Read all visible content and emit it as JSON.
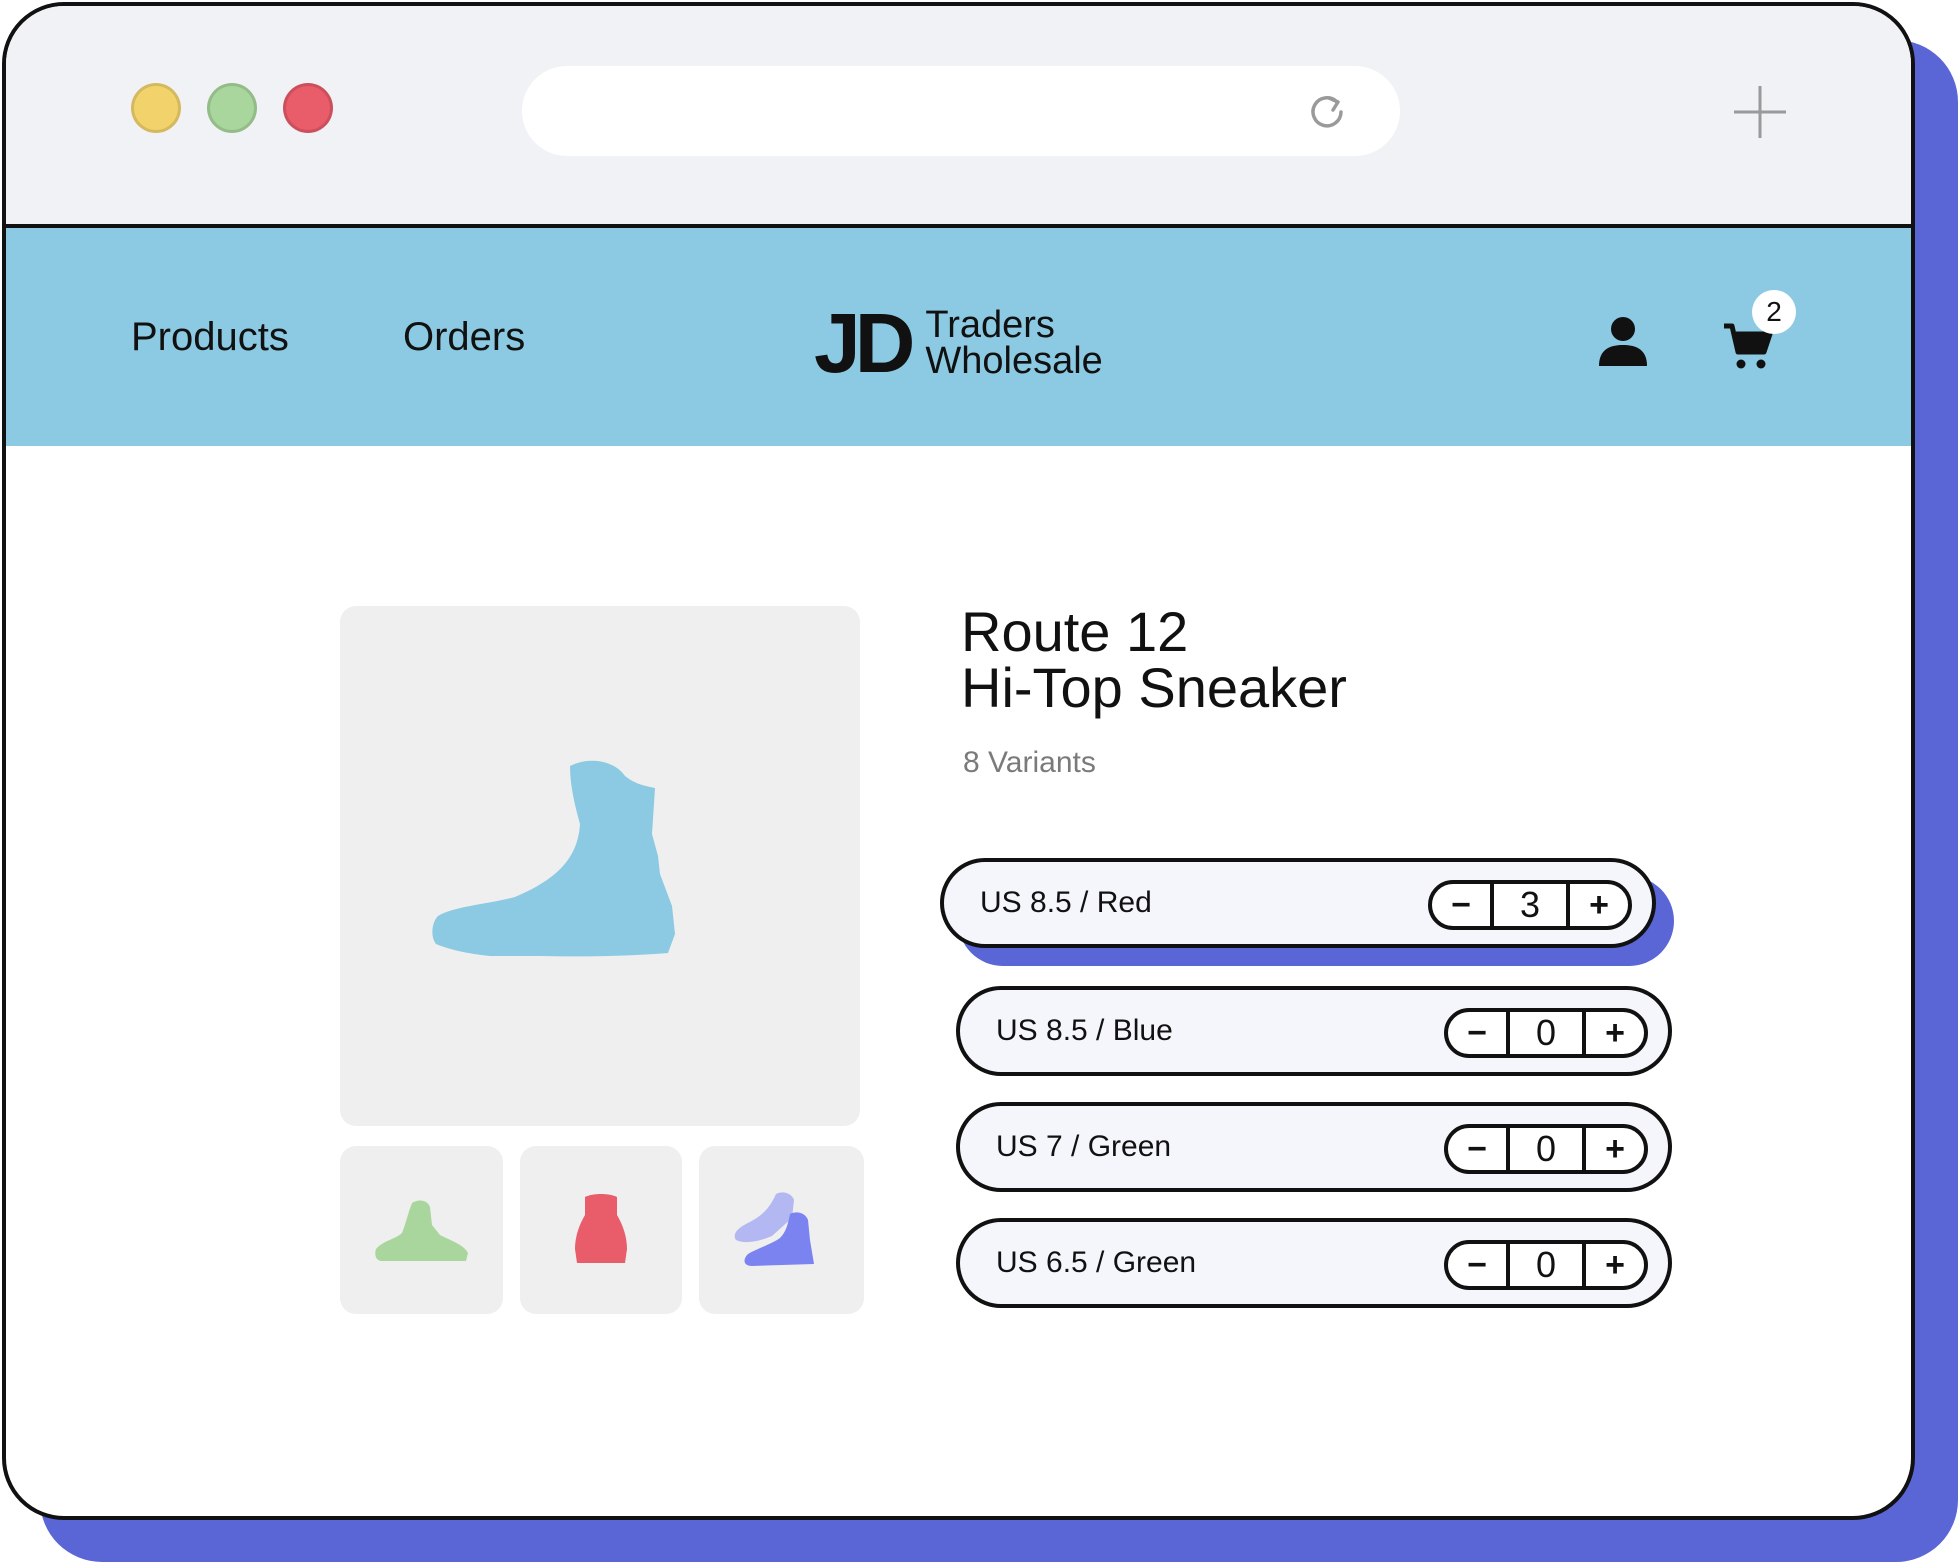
{
  "colors": {
    "accent": "#5a66d6",
    "navbar": "#8bcae2",
    "traffic_yellow": "#f2d36b",
    "traffic_green": "#a9d69c",
    "traffic_red": "#e95c69",
    "shoe_blue": "#8bcae2",
    "shoe_green": "#a9d69c",
    "shoe_red": "#e95c69",
    "shoe_purple": "#7b83f0"
  },
  "browser": {
    "icons": [
      "reload-icon",
      "new-tab-icon"
    ]
  },
  "nav": {
    "links": [
      {
        "label": "Products"
      },
      {
        "label": "Orders"
      }
    ],
    "brand": {
      "mark": "JD",
      "line1": "Traders",
      "line2": "Wholesale"
    },
    "cart_count": "2",
    "icons": [
      "user-icon",
      "cart-icon"
    ]
  },
  "product": {
    "title_line1": "Route 12",
    "title_line2": "Hi-Top Sneaker",
    "variant_count": "8 Variants",
    "thumbnails": [
      "green",
      "red",
      "purple"
    ],
    "variants": [
      {
        "label": "US 8.5 / Red",
        "qty": "3",
        "selected": true
      },
      {
        "label": "US 8.5 / Blue",
        "qty": "0",
        "selected": false
      },
      {
        "label": "US 7 / Green",
        "qty": "0",
        "selected": false
      },
      {
        "label": "US 6.5 / Green",
        "qty": "0",
        "selected": false
      }
    ],
    "stepper": {
      "minus": "−",
      "plus": "+"
    }
  }
}
